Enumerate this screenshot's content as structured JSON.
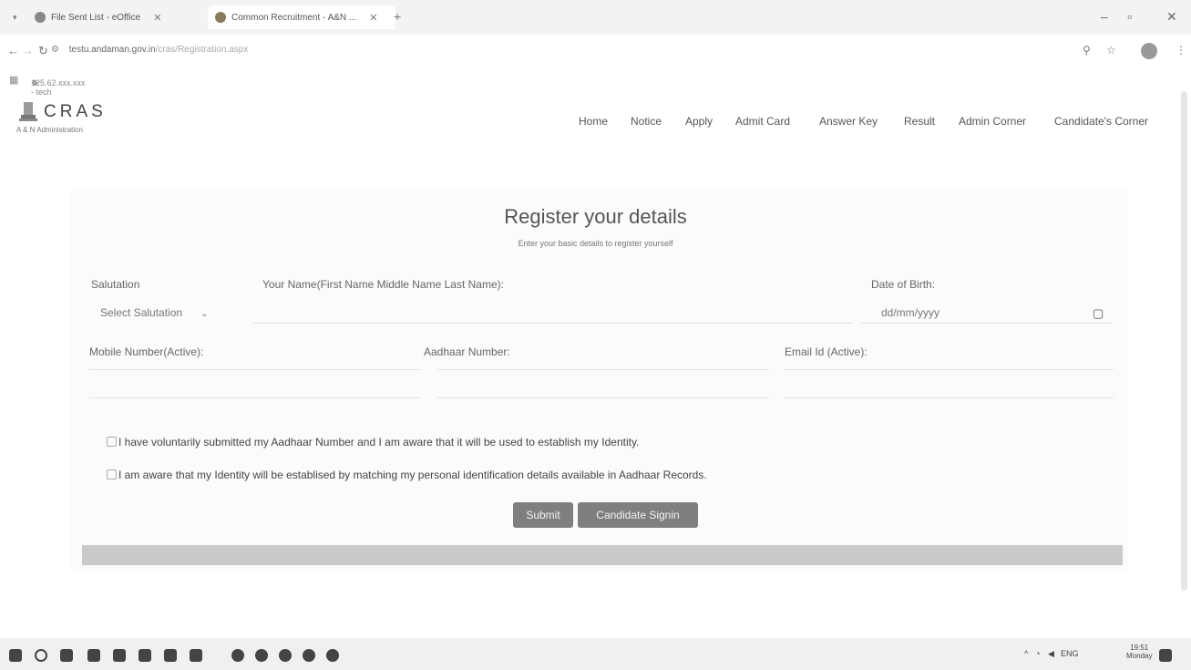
{
  "browser": {
    "tabs": [
      {
        "title": "File Sent List - eOffice"
      },
      {
        "title": "Common Recruitment - A&N ..."
      }
    ],
    "new_tab": "+",
    "url_host": "testu.andaman.gov.in",
    "url_path": "/cras/Registration.aspx",
    "bookmark": "125.62.xxx.xxx - tech"
  },
  "site": {
    "logo": "CRAS",
    "logo_sub": "A & N Administration",
    "menu": [
      "Home",
      "Notice",
      "Apply",
      "Admit Card",
      "Answer Key",
      "Result",
      "Admin Corner",
      "Candidate's Corner"
    ]
  },
  "form": {
    "title": "Register your details",
    "subtitle": "Enter your basic details to register yourself",
    "salutation_label": "Salutation",
    "salutation_value": "Select Salutation",
    "name_label": "Your Name(First Name Middle Name Last Name):",
    "dob_label": "Date of Birth:",
    "dob_placeholder": "dd/mm/yyyy",
    "mobile_label": "Mobile Number(Active):",
    "aadhaar_label": "Aadhaar Number:",
    "email_label": "Email Id (Active):",
    "consent1": "I have voluntarily submitted my Aadhaar Number and I am aware that it will be used to establish my Identity.",
    "consent2": "I am aware that my Identity will be establised by matching my personal identification details available in Aadhaar Records.",
    "submit": "Submit",
    "signin": "Candidate Signin"
  },
  "taskbar": {
    "lang": "ENG",
    "time": "19:51",
    "day": "Monday"
  },
  "colors": {
    "button_bg": "#7f7f7f",
    "band": "#c9c9c9"
  }
}
